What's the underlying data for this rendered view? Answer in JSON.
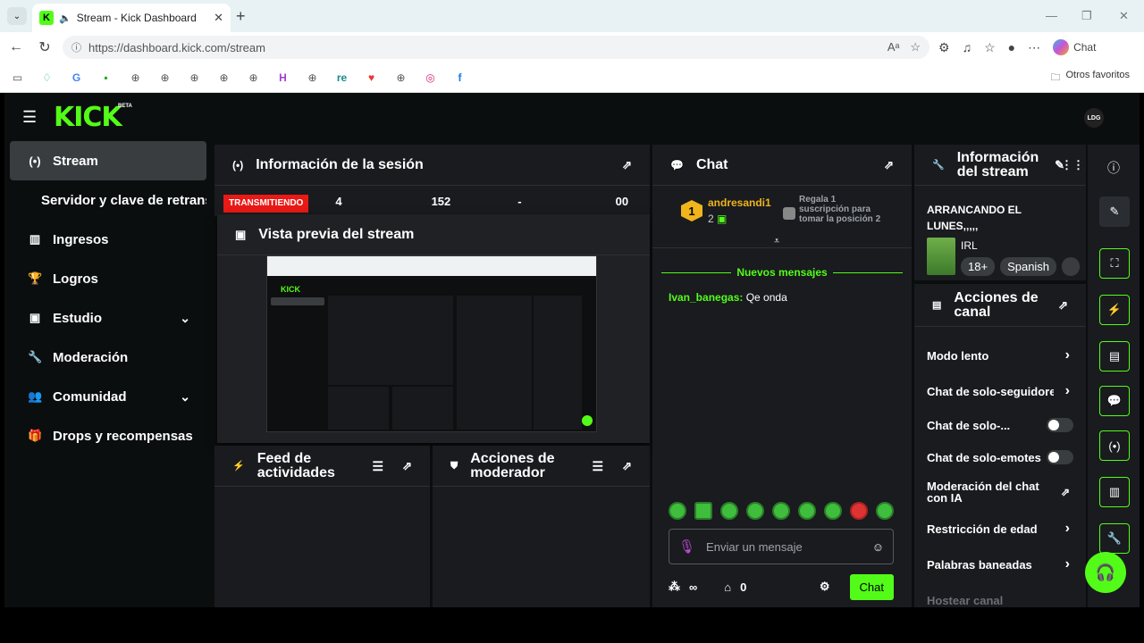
{
  "browser": {
    "tab_title": "Stream - Kick Dashboard",
    "url": "https://dashboard.kick.com/stream",
    "chat_label": "Chat",
    "bookmarks_folder": "Otros favoritos"
  },
  "sidebar": {
    "items": [
      {
        "label": "Stream",
        "icon": "broadcast-icon"
      },
      {
        "label": "Servidor y clave de retransmisión"
      },
      {
        "label": "Ingresos",
        "icon": "chart-icon"
      },
      {
        "label": "Logros",
        "icon": "trophy-icon"
      },
      {
        "label": "Estudio",
        "icon": "studio-icon"
      },
      {
        "label": "Moderación",
        "icon": "wrench-icon"
      },
      {
        "label": "Comunidad",
        "icon": "users-icon"
      },
      {
        "label": "Drops y recompensas",
        "icon": "gift-icon"
      }
    ]
  },
  "session": {
    "title": "Información de la sesión",
    "live_label": "TRANSMITIENDO",
    "stats": [
      "4",
      "152",
      "-",
      "00"
    ]
  },
  "preview": {
    "title": "Vista previa del stream"
  },
  "feed": {
    "title": "Feed de actividades"
  },
  "modactions": {
    "title": "Acciones de moderador"
  },
  "chat": {
    "title": "Chat",
    "pinned_user": "andresandi1",
    "pinned_rank": "1",
    "pinned_count": "2",
    "gift_text": "Regala 1 suscripción para tomar la posición 2",
    "new_messages": "Nuevos mensajes",
    "msg_user": "Ivan_banegas:",
    "msg_text": "Qe onda",
    "input_placeholder": "Enviar un mensaje",
    "points": "∞",
    "store_count": "0",
    "send_label": "Chat"
  },
  "info": {
    "title": "Información del stream",
    "stream_title": "ARRANCANDO EL LUNES,,,,,",
    "category": "IRL",
    "tags": [
      "18+",
      "Spanish"
    ]
  },
  "channel_actions": {
    "title": "Acciones de canal",
    "items": [
      "Modo lento",
      "Chat de solo-seguidores",
      "Chat de solo-...",
      "Chat de solo-emotes",
      "Moderación del chat con IA",
      "Restricción de edad",
      "Palabras baneadas",
      "Hostear canal"
    ]
  },
  "colors": {
    "accent": "#53fc18",
    "panel": "#191b1f",
    "live": "#e91916"
  }
}
